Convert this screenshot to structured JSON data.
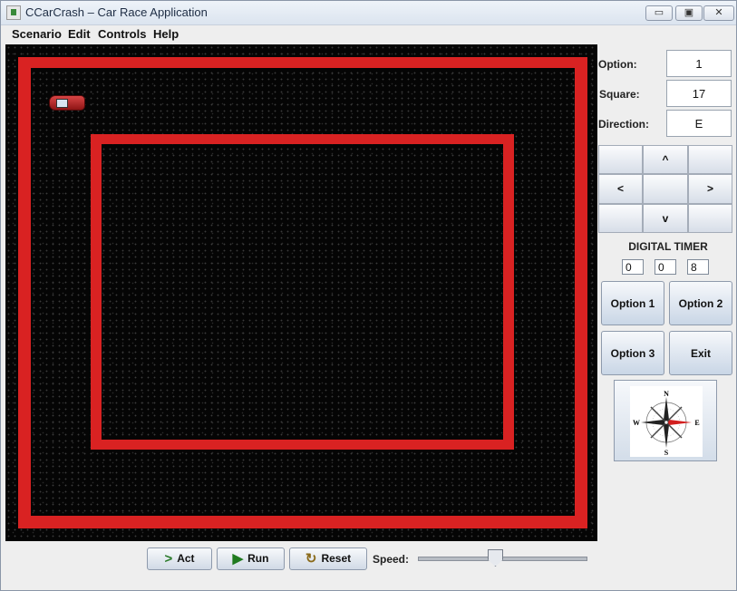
{
  "window": {
    "title": "CCarCrash – Car Race Application",
    "buttons": {
      "minimize": "▭",
      "maximize": "▣",
      "close": "✕"
    }
  },
  "menu": [
    "Scenario",
    "Edit",
    "Controls",
    "Help"
  ],
  "info": [
    {
      "label": "Option:",
      "value": "1"
    },
    {
      "label": "Square:",
      "value": "17"
    },
    {
      "label": "Direction:",
      "value": "E"
    }
  ],
  "pad": {
    "up": "^",
    "left": "<",
    "right": ">",
    "down": "v"
  },
  "timer": {
    "label": "DIGITAL TIMER",
    "values": [
      "0",
      "0",
      "8"
    ]
  },
  "options": {
    "option1": "Option 1",
    "option2": "Option 2",
    "option3": "Option 3",
    "exit": "Exit"
  },
  "compass": {
    "n": "N",
    "s": "S",
    "e": "E",
    "w": "W"
  },
  "controls": {
    "act": "Act",
    "run": "Run",
    "reset": "Reset",
    "speed_label": "Speed:",
    "speed_fraction": 0.45
  },
  "colors": {
    "track": "#d92222",
    "car": "#b52a2a",
    "background": "#050505"
  }
}
